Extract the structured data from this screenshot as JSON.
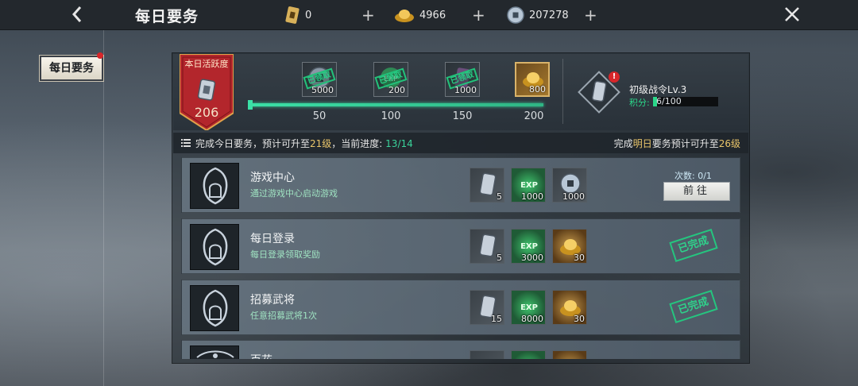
{
  "header": {
    "title": "每日要务",
    "currencies": [
      {
        "name": "token-icon",
        "value": "0"
      },
      {
        "name": "gold-ingot-icon",
        "value": "4966"
      },
      {
        "name": "coin-icon",
        "value": "207278"
      }
    ],
    "plus_label": "+"
  },
  "side_tab": {
    "label": "每日要务"
  },
  "activity": {
    "banner_label": "本日活跃度",
    "banner_value": "206",
    "progress_value": 206,
    "progress_max": 200,
    "milestones": [
      {
        "threshold": "50",
        "reward_qty": "5000",
        "reward": "coin-icon",
        "status": "已领取"
      },
      {
        "threshold": "100",
        "reward_qty": "200",
        "reward": "exp-icon",
        "status": "已领取"
      },
      {
        "threshold": "150",
        "reward_qty": "1000",
        "reward": "token-icon",
        "status": "已领取"
      },
      {
        "threshold": "200",
        "reward_qty": "800",
        "reward": "gold-ingot-icon",
        "status": ""
      }
    ]
  },
  "war_order": {
    "title": "初级战令Lv.3",
    "score_label": "积分:",
    "score_text": "6/100",
    "score_value": 6,
    "score_max": 100,
    "alert": "!"
  },
  "info": {
    "left_prefix": "完成今日要务，预计可升至",
    "left_level": "21级",
    "left_mid": "，当前进度:",
    "left_progress": "13/14",
    "right_prefix": "完成",
    "right_hl": "明日",
    "right_mid": "要务预计可升至",
    "right_level": "26级"
  },
  "quests": [
    {
      "name": "游戏中心",
      "desc": "通过游戏中心启动游戏",
      "rewards": [
        {
          "icon": "token-icon",
          "qty": "5",
          "style": ""
        },
        {
          "icon": "exp-icon",
          "qty": "1000",
          "style": "green"
        },
        {
          "icon": "coin-icon",
          "qty": "1000",
          "style": ""
        }
      ],
      "count_label": "次数:",
      "count_value": "0/1",
      "action": "前往",
      "done": false
    },
    {
      "name": "每日登录",
      "desc": "每日登录领取奖励",
      "rewards": [
        {
          "icon": "token-icon",
          "qty": "5",
          "style": ""
        },
        {
          "icon": "exp-icon",
          "qty": "3000",
          "style": "green"
        },
        {
          "icon": "gold-ingot-icon",
          "qty": "30",
          "style": "gold"
        }
      ],
      "done_label": "已完成",
      "done": true
    },
    {
      "name": "招募武将",
      "desc": "任意招募武将1次",
      "rewards": [
        {
          "icon": "token-icon",
          "qty": "15",
          "style": ""
        },
        {
          "icon": "exp-icon",
          "qty": "8000",
          "style": "green"
        },
        {
          "icon": "gold-ingot-icon",
          "qty": "30",
          "style": "gold"
        }
      ],
      "done_label": "已完成",
      "done": true
    },
    {
      "name": "百花",
      "desc": "",
      "rewards": [],
      "done": true
    }
  ],
  "colors": {
    "accent_green": "#2bd88a",
    "highlight_yellow": "#e9c56a",
    "banner_red": "#b3262c"
  }
}
